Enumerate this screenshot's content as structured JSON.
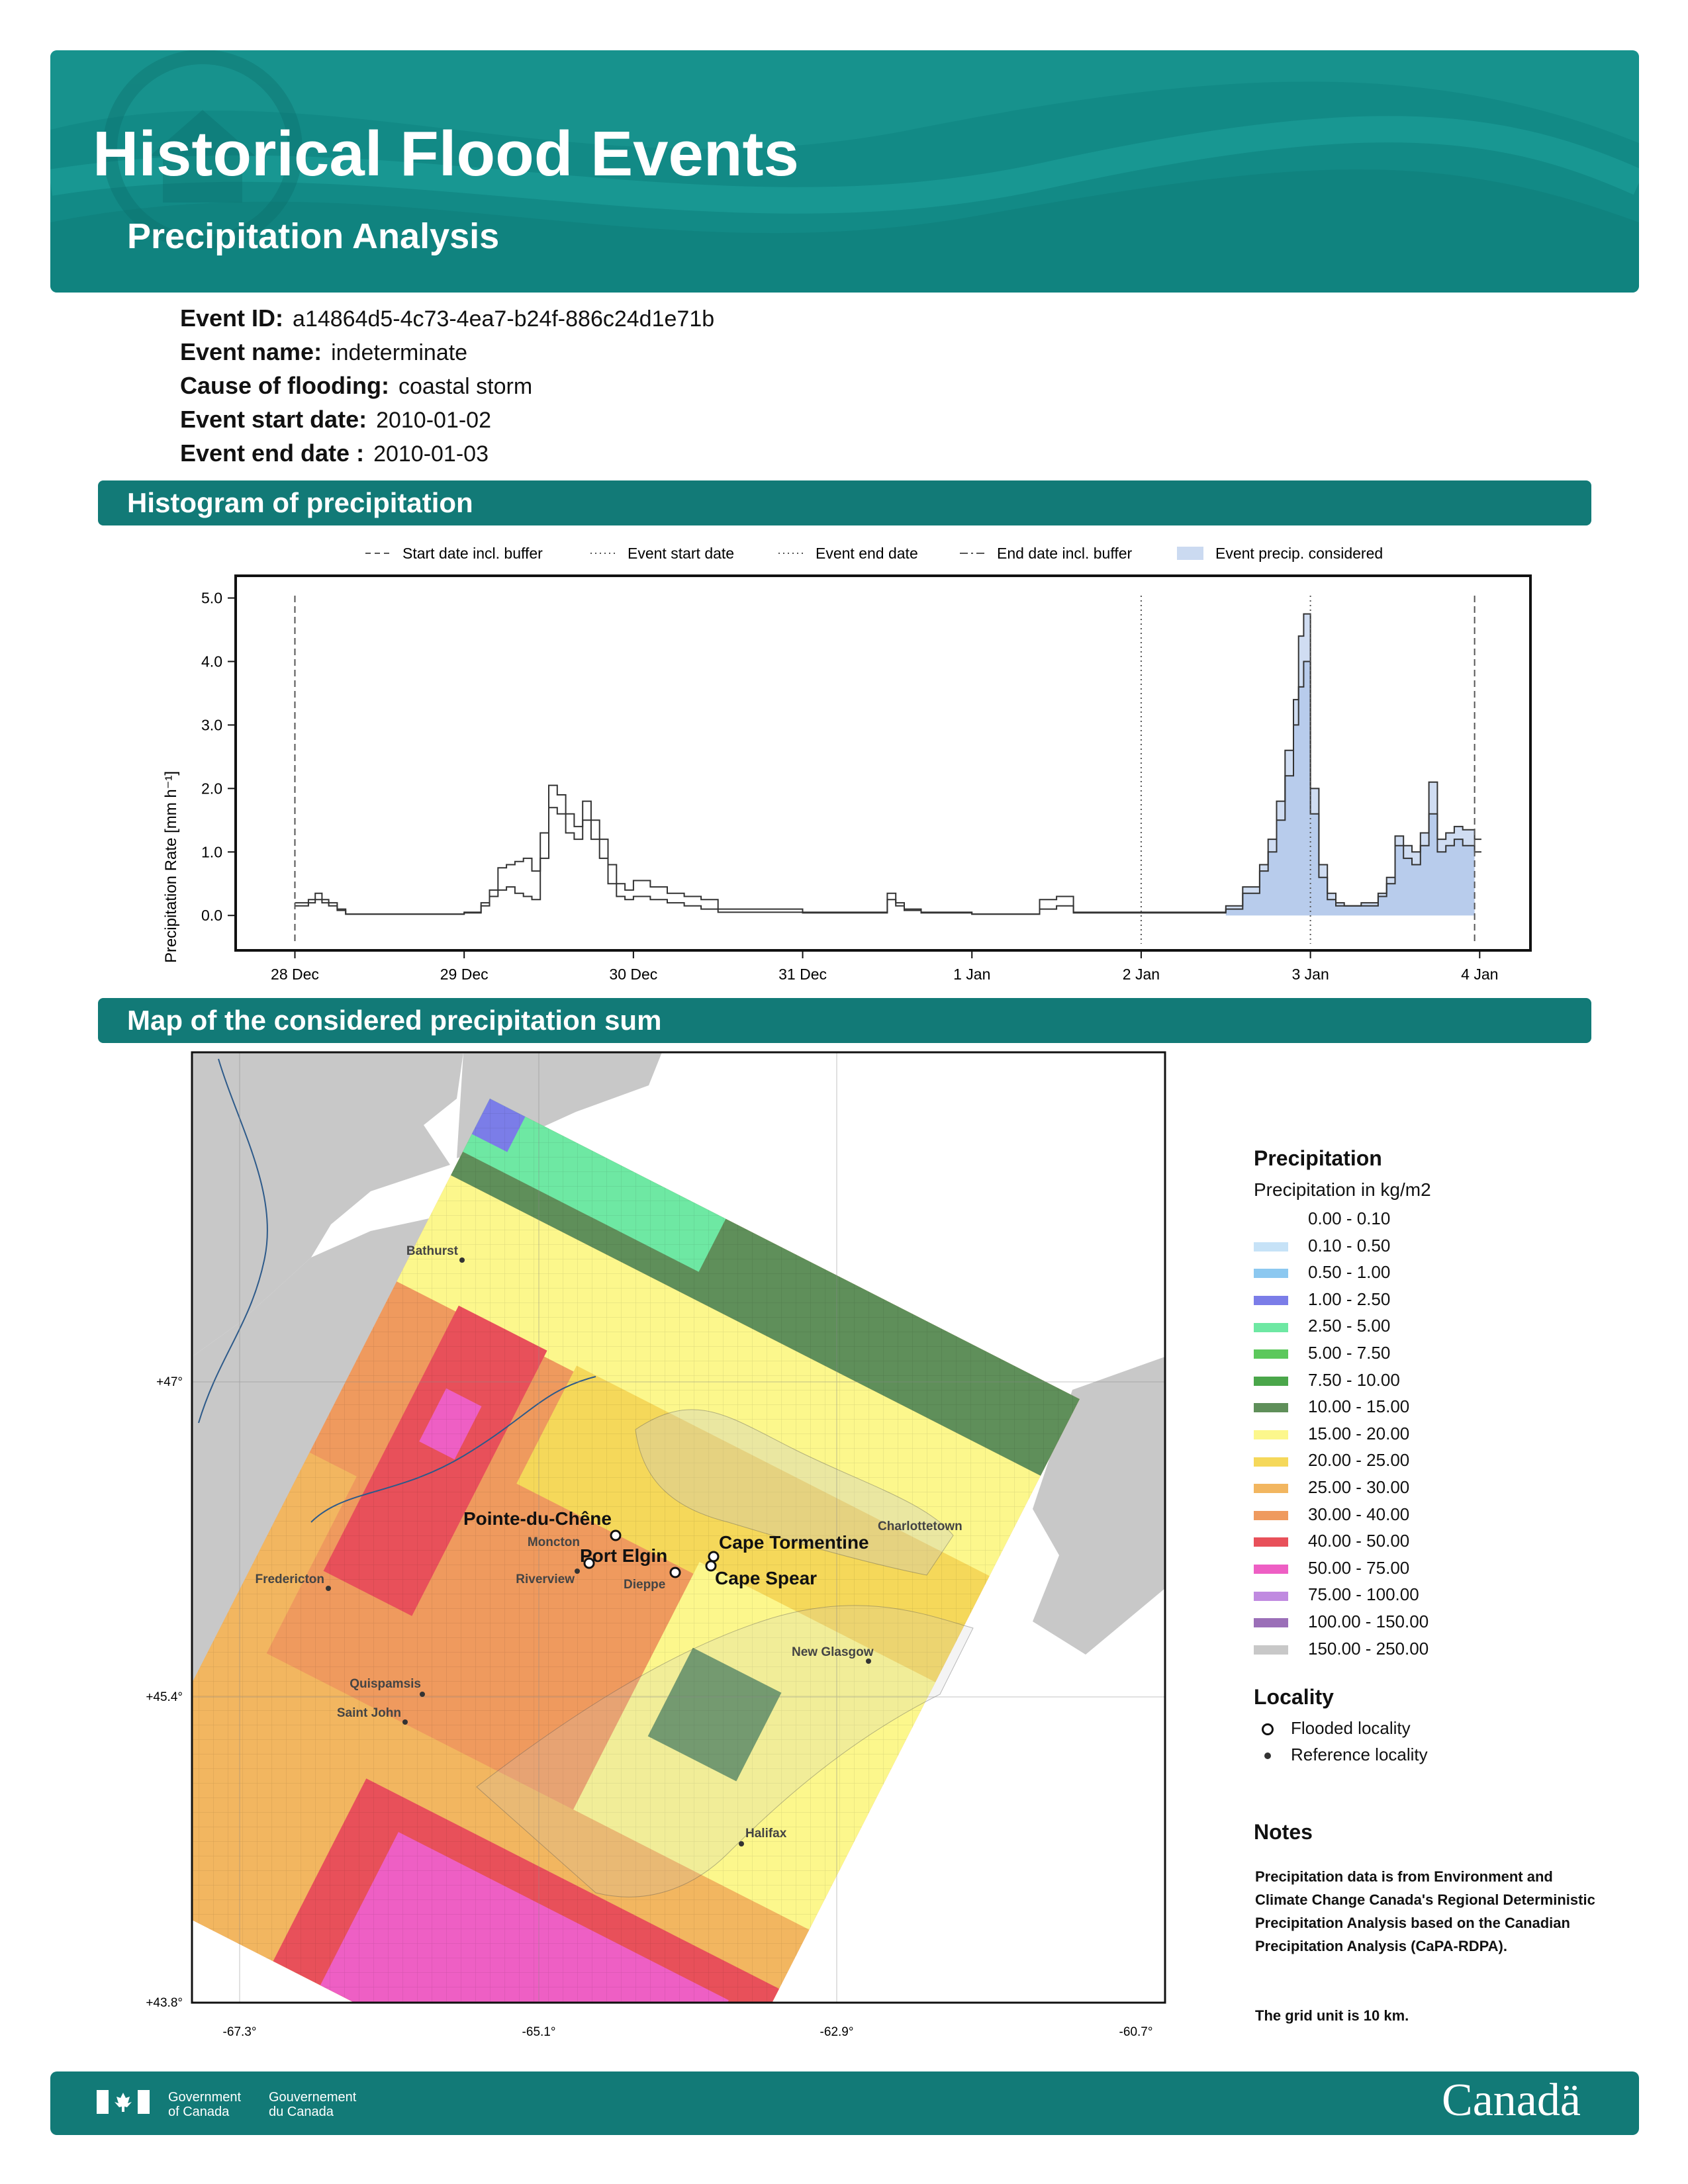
{
  "header": {
    "title": "Historical Flood Events",
    "subtitle": "Precipitation Analysis"
  },
  "event": {
    "id_label": "Event ID:",
    "id_value": "a14864d5-4c73-4ea7-b24f-886c24d1e71b",
    "name_label": "Event name:",
    "name_value": "indeterminate",
    "cause_label": "Cause of flooding:",
    "cause_value": "coastal storm",
    "start_label": "Event start date:",
    "start_value": "2010-01-02",
    "end_label": "Event end date :",
    "end_value": "2010-01-03"
  },
  "sections": {
    "histogram": "Histogram of precipitation",
    "map": "Map of the considered precipitation sum"
  },
  "chart_data": {
    "type": "line",
    "ylabel": "Precipitation Rate [mm h⁻¹]",
    "ylim": [
      0,
      5
    ],
    "y_ticks": [
      "0.0",
      "1.0",
      "2.0",
      "3.0",
      "4.0",
      "5.0"
    ],
    "x_ticks": [
      "28 Dec",
      "29 Dec",
      "30 Dec",
      "31 Dec",
      "1 Jan",
      "2 Jan",
      "3 Jan",
      "4 Jan"
    ],
    "xlim_days": [
      -0.35,
      7.3
    ],
    "legend": [
      {
        "label": "Start date incl. buffer",
        "style": "dashed"
      },
      {
        "label": "Event start date",
        "style": "dotted"
      },
      {
        "label": "Event end date",
        "style": "dotted"
      },
      {
        "label": "End date incl. buffer",
        "style": "dashdot"
      },
      {
        "label": "Event precip. considered",
        "style": "fill"
      }
    ],
    "vlines": [
      {
        "x_day": 0.0,
        "style": "dashed"
      },
      {
        "x_day": 5.0,
        "style": "dotted"
      },
      {
        "x_day": 6.0,
        "style": "dotted"
      },
      {
        "x_day": 6.97,
        "style": "dashed"
      }
    ],
    "considered_range_days": [
      5.5,
      6.97
    ],
    "series": [
      {
        "x_days": [
          0.0,
          0.08,
          0.12,
          0.16,
          0.2,
          0.25,
          0.3,
          1.0,
          1.1,
          1.15,
          1.2,
          1.25,
          1.3,
          1.35,
          1.4,
          1.45,
          1.5,
          1.55,
          1.6,
          1.65,
          1.7,
          1.75,
          1.8,
          1.85,
          1.9,
          1.95,
          2.0,
          2.1,
          2.2,
          2.3,
          2.4,
          2.5,
          3.0,
          3.3,
          3.5,
          3.55,
          3.6,
          3.7,
          4.0,
          4.4,
          4.5,
          4.6,
          5.0,
          5.5,
          5.6,
          5.7,
          5.75,
          5.8,
          5.85,
          5.9,
          5.93,
          5.96,
          6.0,
          6.05,
          6.1,
          6.15,
          6.2,
          6.3,
          6.4,
          6.45,
          6.5,
          6.55,
          6.6,
          6.65,
          6.7,
          6.75,
          6.8,
          6.85,
          6.9,
          6.97
        ],
        "values": [
          0.2,
          0.25,
          0.35,
          0.25,
          0.2,
          0.1,
          0.02,
          0.05,
          0.2,
          0.4,
          0.75,
          0.8,
          0.85,
          0.9,
          0.7,
          1.3,
          2.05,
          1.9,
          1.6,
          1.4,
          1.8,
          1.5,
          1.2,
          0.8,
          0.5,
          0.4,
          0.55,
          0.45,
          0.35,
          0.3,
          0.25,
          0.1,
          0.05,
          0.05,
          0.35,
          0.2,
          0.1,
          0.05,
          0.02,
          0.25,
          0.3,
          0.05,
          0.05,
          0.15,
          0.45,
          0.8,
          1.2,
          1.8,
          2.6,
          3.4,
          4.4,
          4.75,
          2.0,
          0.8,
          0.35,
          0.2,
          0.15,
          0.2,
          0.35,
          0.6,
          1.25,
          1.1,
          1.0,
          1.3,
          2.1,
          1.2,
          1.3,
          1.4,
          1.35,
          1.2
        ]
      },
      {
        "x_days": [
          0.0,
          0.08,
          0.12,
          0.16,
          0.2,
          0.25,
          0.3,
          1.0,
          1.1,
          1.15,
          1.2,
          1.25,
          1.3,
          1.35,
          1.4,
          1.45,
          1.5,
          1.55,
          1.6,
          1.65,
          1.7,
          1.75,
          1.8,
          1.85,
          1.9,
          1.95,
          2.0,
          2.1,
          2.2,
          2.3,
          2.4,
          2.5,
          3.0,
          3.3,
          3.5,
          3.55,
          3.6,
          3.7,
          4.0,
          4.4,
          4.5,
          4.6,
          5.0,
          5.5,
          5.6,
          5.7,
          5.75,
          5.8,
          5.85,
          5.9,
          5.93,
          5.96,
          6.0,
          6.05,
          6.1,
          6.15,
          6.2,
          6.3,
          6.4,
          6.45,
          6.5,
          6.55,
          6.6,
          6.65,
          6.7,
          6.75,
          6.8,
          6.85,
          6.9,
          6.97
        ],
        "values": [
          0.15,
          0.2,
          0.25,
          0.2,
          0.15,
          0.08,
          0.02,
          0.04,
          0.15,
          0.3,
          0.4,
          0.45,
          0.35,
          0.3,
          0.25,
          0.9,
          1.7,
          1.6,
          1.3,
          1.2,
          1.5,
          1.2,
          0.9,
          0.5,
          0.3,
          0.25,
          0.3,
          0.25,
          0.2,
          0.15,
          0.1,
          0.05,
          0.04,
          0.04,
          0.25,
          0.15,
          0.08,
          0.04,
          0.02,
          0.1,
          0.15,
          0.04,
          0.04,
          0.1,
          0.35,
          0.7,
          1.0,
          1.5,
          2.2,
          3.0,
          3.6,
          4.0,
          1.6,
          0.6,
          0.25,
          0.15,
          0.15,
          0.15,
          0.3,
          0.5,
          1.1,
          0.9,
          0.8,
          1.1,
          1.6,
          1.0,
          1.1,
          1.2,
          1.1,
          1.0
        ]
      }
    ]
  },
  "map": {
    "lon_ticks": [
      "-67.3°",
      "-65.1°",
      "-62.9°",
      "-60.7°"
    ],
    "lat_ticks": [
      "+47°",
      "+45.4°",
      "+43.8°"
    ],
    "flooded": [
      "Pointe-du-Chêne",
      "Port Elgin",
      "Cape Tormentine",
      "Cape Spear"
    ],
    "reference": [
      "Bathurst",
      "Moncton",
      "Riverview",
      "Dieppe",
      "Fredericton",
      "Charlottetown",
      "New Glasgow",
      "Quispamsis",
      "Saint John",
      "Halifax"
    ]
  },
  "legend": {
    "title": "Precipitation",
    "subtitle": "Precipitation in kg/m2",
    "bins": [
      {
        "label": "0.00 - 0.10",
        "color": "#ffffff"
      },
      {
        "label": "0.10 - 0.50",
        "color": "#c6e2f7"
      },
      {
        "label": "0.50 - 1.00",
        "color": "#8cc8f0"
      },
      {
        "label": "1.00 - 2.50",
        "color": "#7b7de8"
      },
      {
        "label": "2.50 - 5.00",
        "color": "#6ee8a3"
      },
      {
        "label": "5.00 - 7.50",
        "color": "#5cc85c"
      },
      {
        "label": "7.50 - 10.00",
        "color": "#4aa64a"
      },
      {
        "label": "10.00 - 15.00",
        "color": "#5f8f5a"
      },
      {
        "label": "15.00 - 20.00",
        "color": "#fcf78c"
      },
      {
        "label": "20.00 - 25.00",
        "color": "#f5d85a"
      },
      {
        "label": "25.00 - 30.00",
        "color": "#f2b660"
      },
      {
        "label": "30.00 - 40.00",
        "color": "#ef9a5e"
      },
      {
        "label": "40.00 - 50.00",
        "color": "#e8505a"
      },
      {
        "label": "50.00 - 75.00",
        "color": "#ee5fc4"
      },
      {
        "label": "75.00 - 100.00",
        "color": "#c08ae0"
      },
      {
        "label": "100.00 - 150.00",
        "color": "#9b6fb8"
      },
      {
        "label": "150.00 - 250.00",
        "color": "#c8c8c8"
      }
    ],
    "locality_title": "Locality",
    "flooded_label": "Flooded locality",
    "reference_label": "Reference locality",
    "notes_title": "Notes",
    "notes_text": "Precipitation data is from Environment and Climate Change Canada's Regional Deterministic Precipitation Analysis based on the Canadian Precipitation Analysis (CaPA-RDPA).",
    "grid_note": "The grid unit is 10 km."
  },
  "footer": {
    "gov_en_1": "Government",
    "gov_en_2": "of Canada",
    "gov_fr_1": "Gouvernement",
    "gov_fr_2": "du Canada",
    "wordmark": "Canadä"
  }
}
